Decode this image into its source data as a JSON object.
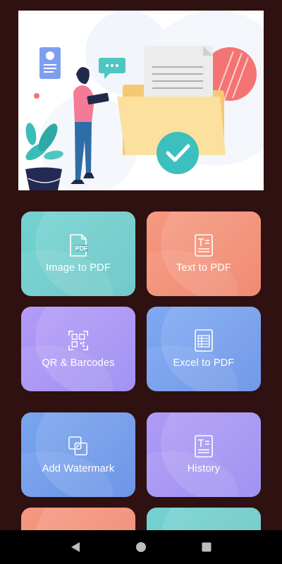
{
  "cards": [
    {
      "label": "Image to PDF",
      "icon": "image-pdf-icon"
    },
    {
      "label": "Text to PDF",
      "icon": "text-pdf-icon"
    },
    {
      "label": "QR & Barcodes",
      "icon": "qr-scan-icon"
    },
    {
      "label": "Excel to PDF",
      "icon": "excel-sheet-icon"
    },
    {
      "label": "Add Watermark",
      "icon": "watermark-icon"
    },
    {
      "label": "History",
      "icon": "history-doc-icon"
    }
  ],
  "icon_badge_text": "PDF",
  "colors": {
    "background": "#2e1110",
    "teal": "#5fc2c3",
    "coral": "#ef7b5f",
    "purple": "#9584f2",
    "blue": "#5f8be6"
  },
  "navbar": {
    "back": "back-triangle-icon",
    "home": "home-circle-icon",
    "recents": "recents-square-icon"
  }
}
